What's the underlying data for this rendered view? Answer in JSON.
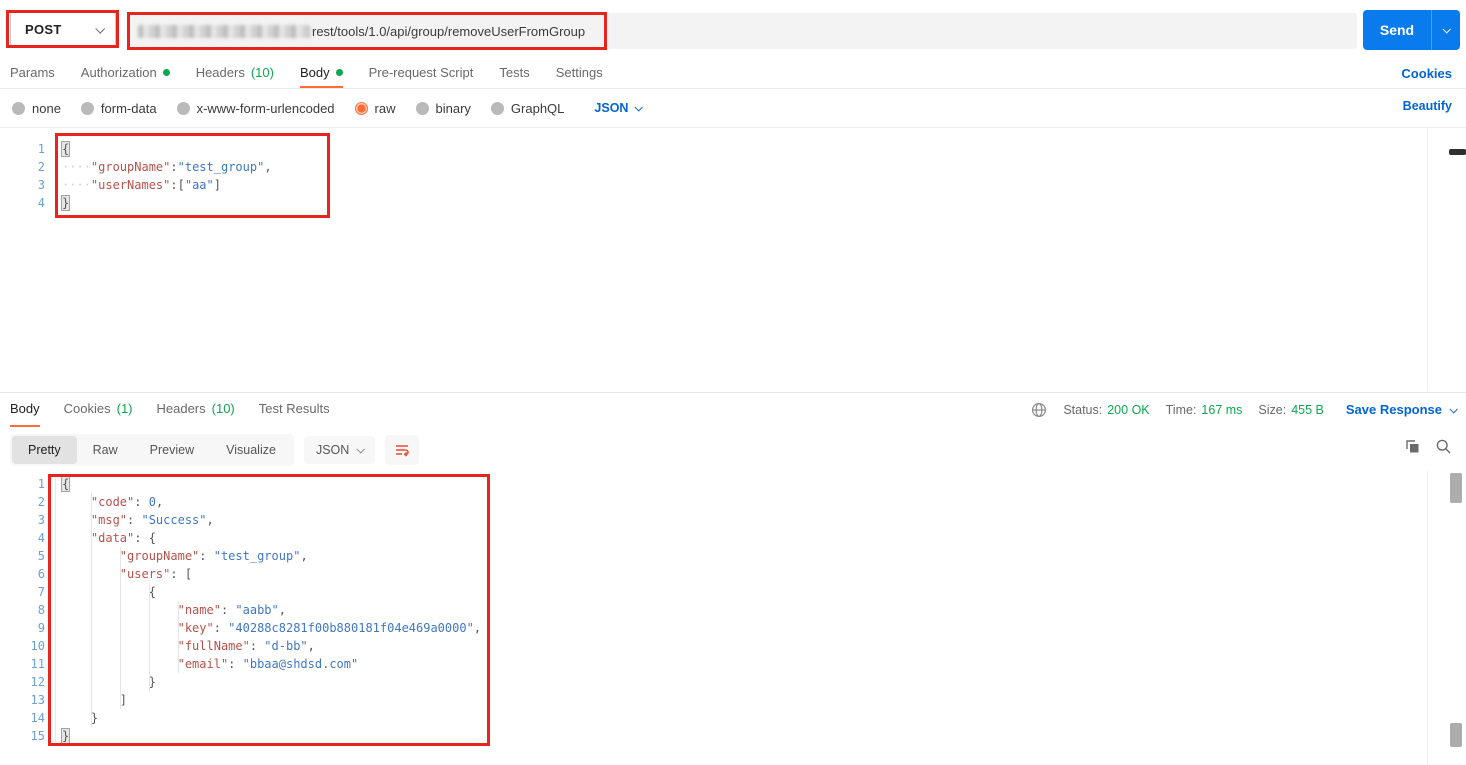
{
  "colors": {
    "accent_orange": "#ff6c37",
    "send_blue": "#097bed",
    "link_blue": "#0265d2",
    "green": "#0da750",
    "annotation_red": "#e8241f",
    "json_key_red": "#b5524b",
    "json_value_blue": "#4077c2",
    "line_number_blue": "#6a9fd8"
  },
  "request": {
    "method": "POST",
    "url_path": "rest/tools/1.0/api/group/removeUserFromGroup",
    "send_label": "Send",
    "cookies_link": "Cookies",
    "tabs": [
      {
        "label": "Params"
      },
      {
        "label": "Authorization",
        "dot": true
      },
      {
        "label": "Headers",
        "count": "(10)"
      },
      {
        "label": "Body",
        "dot": true,
        "active": true
      },
      {
        "label": "Pre-request Script"
      },
      {
        "label": "Tests"
      },
      {
        "label": "Settings"
      }
    ],
    "body_modes": [
      {
        "label": "none"
      },
      {
        "label": "form-data"
      },
      {
        "label": "x-www-form-urlencoded"
      },
      {
        "label": "raw",
        "selected": true
      },
      {
        "label": "binary"
      },
      {
        "label": "GraphQL"
      }
    ],
    "language_select": "JSON",
    "beautify_link": "Beautify",
    "body_lines": [
      [
        [
          "brkt",
          "{"
        ]
      ],
      [
        [
          "ws",
          "····"
        ],
        [
          "key",
          "\"groupName\""
        ],
        [
          "p",
          ":"
        ],
        [
          "str",
          "\"test_group\""
        ],
        [
          "p",
          ","
        ]
      ],
      [
        [
          "ws",
          "····"
        ],
        [
          "key",
          "\"userNames\""
        ],
        [
          "p",
          ":"
        ],
        [
          "p",
          "["
        ],
        [
          "str",
          "\"aa\""
        ],
        [
          "p",
          "]"
        ]
      ],
      [
        [
          "brkt",
          "}"
        ]
      ]
    ]
  },
  "response": {
    "tabs": [
      {
        "label": "Body",
        "active": true
      },
      {
        "label": "Cookies",
        "count": "(1)"
      },
      {
        "label": "Headers",
        "count": "(10)"
      },
      {
        "label": "Test Results"
      }
    ],
    "meta": {
      "status_label": "Status:",
      "status_value": "200 OK",
      "time_label": "Time:",
      "time_value": "167 ms",
      "size_label": "Size:",
      "size_value": "455 B",
      "save_response": "Save Response"
    },
    "view_tabs": [
      {
        "label": "Pretty",
        "active": true
      },
      {
        "label": "Raw"
      },
      {
        "label": "Preview"
      },
      {
        "label": "Visualize"
      }
    ],
    "language_select": "JSON",
    "body_lines": [
      [
        [
          "brkt",
          "{"
        ]
      ],
      [
        [
          "sp",
          "    "
        ],
        [
          "key",
          "\"code\""
        ],
        [
          "p",
          ": "
        ],
        [
          "num",
          "0"
        ],
        [
          "p",
          ","
        ]
      ],
      [
        [
          "sp",
          "    "
        ],
        [
          "key",
          "\"msg\""
        ],
        [
          "p",
          ": "
        ],
        [
          "str",
          "\"Success\""
        ],
        [
          "p",
          ","
        ]
      ],
      [
        [
          "sp",
          "    "
        ],
        [
          "key",
          "\"data\""
        ],
        [
          "p",
          ": "
        ],
        [
          "p",
          "{"
        ]
      ],
      [
        [
          "sp",
          "        "
        ],
        [
          "key",
          "\"groupName\""
        ],
        [
          "p",
          ": "
        ],
        [
          "str",
          "\"test_group\""
        ],
        [
          "p",
          ","
        ]
      ],
      [
        [
          "sp",
          "        "
        ],
        [
          "key",
          "\"users\""
        ],
        [
          "p",
          ": "
        ],
        [
          "p",
          "["
        ]
      ],
      [
        [
          "sp",
          "            "
        ],
        [
          "p",
          "{"
        ]
      ],
      [
        [
          "sp",
          "                "
        ],
        [
          "key",
          "\"name\""
        ],
        [
          "p",
          ": "
        ],
        [
          "str",
          "\"aabb\""
        ],
        [
          "p",
          ","
        ]
      ],
      [
        [
          "sp",
          "                "
        ],
        [
          "key",
          "\"key\""
        ],
        [
          "p",
          ": "
        ],
        [
          "str",
          "\"40288c8281f00b880181f04e469a0000\""
        ],
        [
          "p",
          ","
        ]
      ],
      [
        [
          "sp",
          "                "
        ],
        [
          "key",
          "\"fullName\""
        ],
        [
          "p",
          ": "
        ],
        [
          "str",
          "\"d-bb\""
        ],
        [
          "p",
          ","
        ]
      ],
      [
        [
          "sp",
          "                "
        ],
        [
          "key",
          "\"email\""
        ],
        [
          "p",
          ": "
        ],
        [
          "str",
          "\"bbaa@shdsd.com\""
        ]
      ],
      [
        [
          "sp",
          "            "
        ],
        [
          "p",
          "}"
        ]
      ],
      [
        [
          "sp",
          "        "
        ],
        [
          "p",
          "]"
        ]
      ],
      [
        [
          "sp",
          "    "
        ],
        [
          "p",
          "}"
        ]
      ],
      [
        [
          "brkt",
          "}"
        ]
      ]
    ]
  }
}
